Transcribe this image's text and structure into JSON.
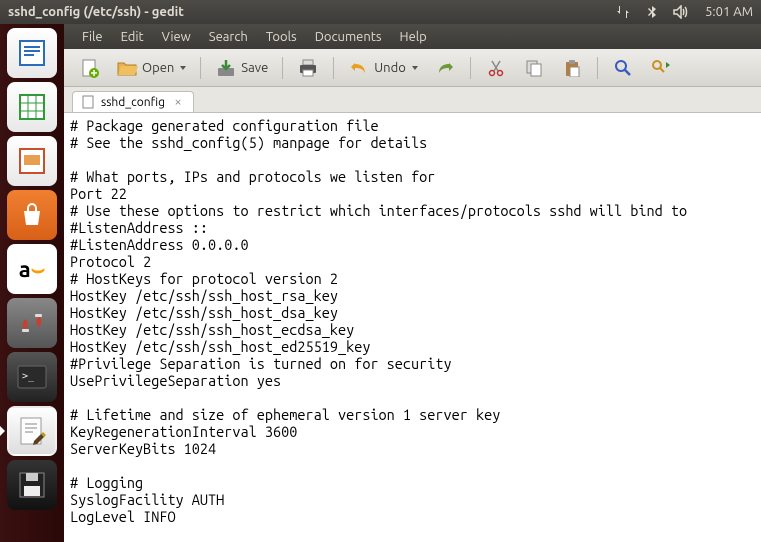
{
  "top_panel": {
    "title": "sshd_config (/etc/ssh) - gedit",
    "time": "5:01 AM"
  },
  "menubar": {
    "items": [
      "File",
      "Edit",
      "View",
      "Search",
      "Tools",
      "Documents",
      "Help"
    ]
  },
  "toolbar": {
    "open_label": "Open",
    "save_label": "Save",
    "undo_label": "Undo"
  },
  "tabs": [
    {
      "label": "sshd_config"
    }
  ],
  "launcher": {
    "items": [
      "libreoffice-writer",
      "libreoffice-calc",
      "libreoffice-impress",
      "ubuntu-software",
      "amazon",
      "system-settings",
      "terminal",
      "text-editor",
      "save-disk"
    ]
  },
  "editor": {
    "lines": [
      "# Package generated configuration file",
      "# See the sshd_config(5) manpage for details",
      "",
      "# What ports, IPs and protocols we listen for",
      "Port 22",
      "# Use these options to restrict which interfaces/protocols sshd will bind to",
      "#ListenAddress ::",
      "#ListenAddress 0.0.0.0",
      "Protocol 2",
      "# HostKeys for protocol version 2",
      "HostKey /etc/ssh/ssh_host_rsa_key",
      "HostKey /etc/ssh/ssh_host_dsa_key",
      "HostKey /etc/ssh/ssh_host_ecdsa_key",
      "HostKey /etc/ssh/ssh_host_ed25519_key",
      "#Privilege Separation is turned on for security",
      "UsePrivilegeSeparation yes",
      "",
      "# Lifetime and size of ephemeral version 1 server key",
      "KeyRegenerationInterval 3600",
      "ServerKeyBits 1024",
      "",
      "# Logging",
      "SyslogFacility AUTH",
      "LogLevel INFO"
    ]
  }
}
